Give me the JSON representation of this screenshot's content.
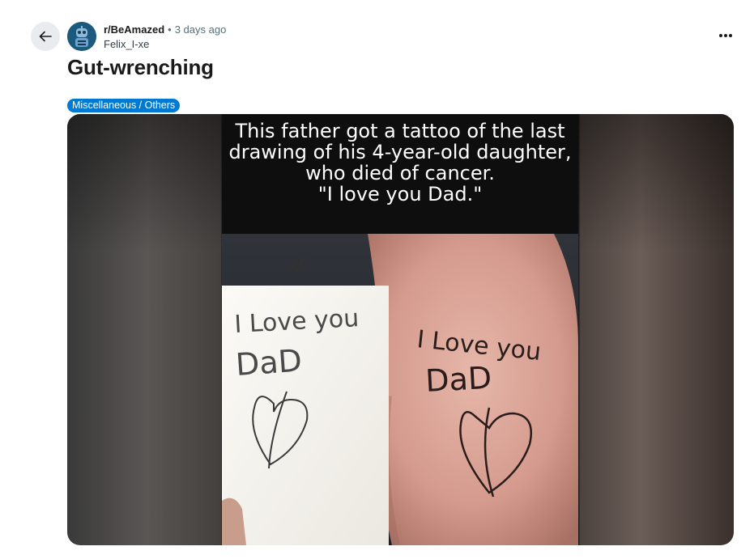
{
  "post": {
    "subreddit": "r/BeAmazed",
    "separator": "•",
    "time": "3 days ago",
    "author": "Felix_I-xe",
    "title": "Gut-wrenching",
    "flair": "Miscellaneous / Others"
  },
  "media": {
    "caption_lines": [
      "This father got a tattoo of the last",
      "drawing of his 4-year-old daughter,",
      "who died of cancer.",
      "\"I love you Dad.\""
    ],
    "paper_text_line1": "I Love you",
    "paper_text_line2": "DaD",
    "tattoo_text_line1": "I Love you",
    "tattoo_text_line2": "DaD"
  },
  "icons": {
    "back": "arrow-left-icon",
    "more": "more-horizontal-icon",
    "avatar": "robot-avatar-icon"
  },
  "colors": {
    "flair_bg": "#0079d3",
    "back_bg": "#e9ecef"
  }
}
